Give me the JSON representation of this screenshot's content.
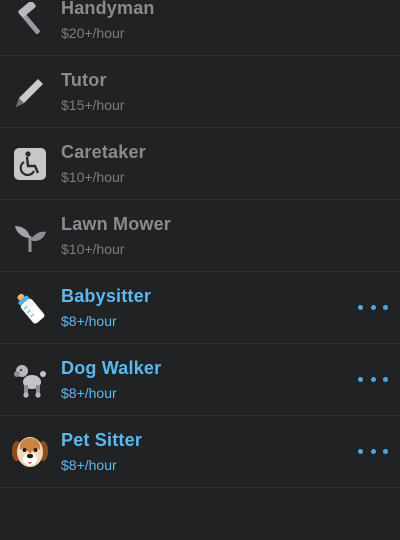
{
  "services": [
    {
      "title": "Handyman",
      "rate": "$20+/hour",
      "icon": "hammer-icon",
      "state": "dim"
    },
    {
      "title": "Tutor",
      "rate": "$15+/hour",
      "icon": "pencil-icon",
      "state": "dim"
    },
    {
      "title": "Caretaker",
      "rate": "$10+/hour",
      "icon": "wheelchair-icon",
      "state": "dim"
    },
    {
      "title": "Lawn Mower",
      "rate": "$10+/hour",
      "icon": "seedling-icon",
      "state": "dim"
    },
    {
      "title": "Babysitter",
      "rate": "$8+/hour",
      "icon": "baby-bottle-icon",
      "state": "active"
    },
    {
      "title": "Dog Walker",
      "rate": "$8+/hour",
      "icon": "poodle-icon",
      "state": "active"
    },
    {
      "title": "Pet Sitter",
      "rate": "$8+/hour",
      "icon": "dog-face-icon",
      "state": "active"
    }
  ],
  "colors": {
    "background": "#212224",
    "active_text": "#5cb8ef",
    "dim_text": "#8a8b8e",
    "more_dots": "#4aa8e6"
  }
}
